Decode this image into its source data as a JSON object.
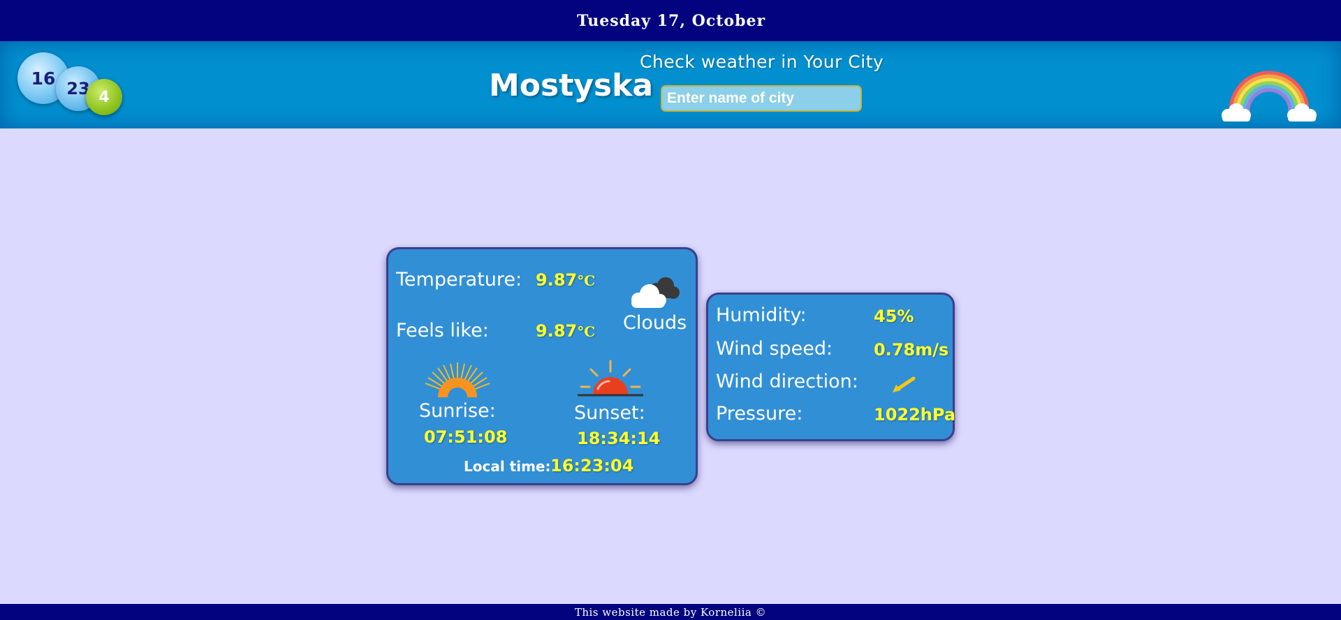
{
  "topbar": {
    "date": "Tuesday 17, October"
  },
  "header": {
    "clock": {
      "hours": "16",
      "minutes": "23",
      "seconds": "4"
    },
    "city": "Mostyska",
    "search_title": "Check weather in Your City",
    "search_placeholder": "Enter name of city",
    "logo_icon": "rainbow-clouds-icon"
  },
  "weather": {
    "temperature_label": "Temperature:",
    "temperature_value": "9.87",
    "temperature_unit": "°C",
    "feels_like_label": "Feels like:",
    "feels_like_value": "9.87",
    "feels_like_unit": "°C",
    "condition": "Clouds",
    "condition_icon": "clouds-icon",
    "sunrise_label": "Sunrise:",
    "sunrise_value": "07:51:08",
    "sunset_label": "Sunset:",
    "sunset_value": "18:34:14",
    "local_time_label": "Local time:",
    "local_time_value": "16:23:04"
  },
  "details": {
    "humidity_label": "Humidity:",
    "humidity_value": "45%",
    "wind_speed_label": "Wind speed:",
    "wind_speed_value": "0.78m/s",
    "wind_direction_label": "Wind direction:",
    "wind_direction_icon": "wind-arrow-icon",
    "pressure_label": "Pressure:",
    "pressure_value": "1022hPa"
  },
  "footer": {
    "text": "This website made by Korneliia ©"
  },
  "colors": {
    "page_bg": "#dcd9ff",
    "topbar_bg": "#03037f",
    "header_bg": "#028fcf",
    "card_bg": "#318fd6",
    "value_yellow": "#ffff2a"
  }
}
